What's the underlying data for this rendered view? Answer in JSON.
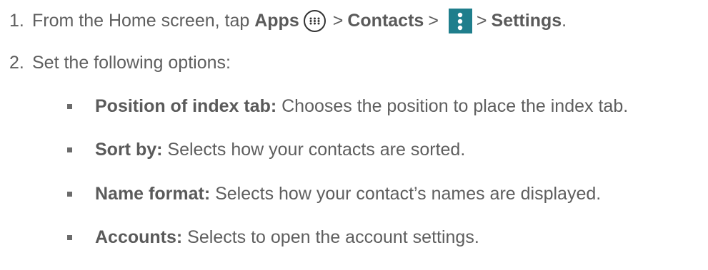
{
  "steps": [
    {
      "number": "1.",
      "prefix": "From the Home screen, tap ",
      "apps_label": "Apps",
      "sep1": ">",
      "contacts_label": "Contacts",
      "sep2": ">",
      "sep3": ">",
      "settings_label": "Settings",
      "suffix": "."
    },
    {
      "number": "2.",
      "text": "Set the following options:"
    }
  ],
  "options": [
    {
      "term": "Position of index tab:",
      "description": " Chooses the position to place the index tab."
    },
    {
      "term": "Sort by:",
      "description": " Selects how your contacts are sorted."
    },
    {
      "term": "Name format:",
      "description": " Selects how your contact’s names are displayed."
    },
    {
      "term": "Accounts:",
      "description": " Selects to open the account settings."
    }
  ],
  "icons": {
    "apps": "apps-grid-icon",
    "menu": "more-options-icon",
    "menu_bg": "#1f7e8c"
  }
}
